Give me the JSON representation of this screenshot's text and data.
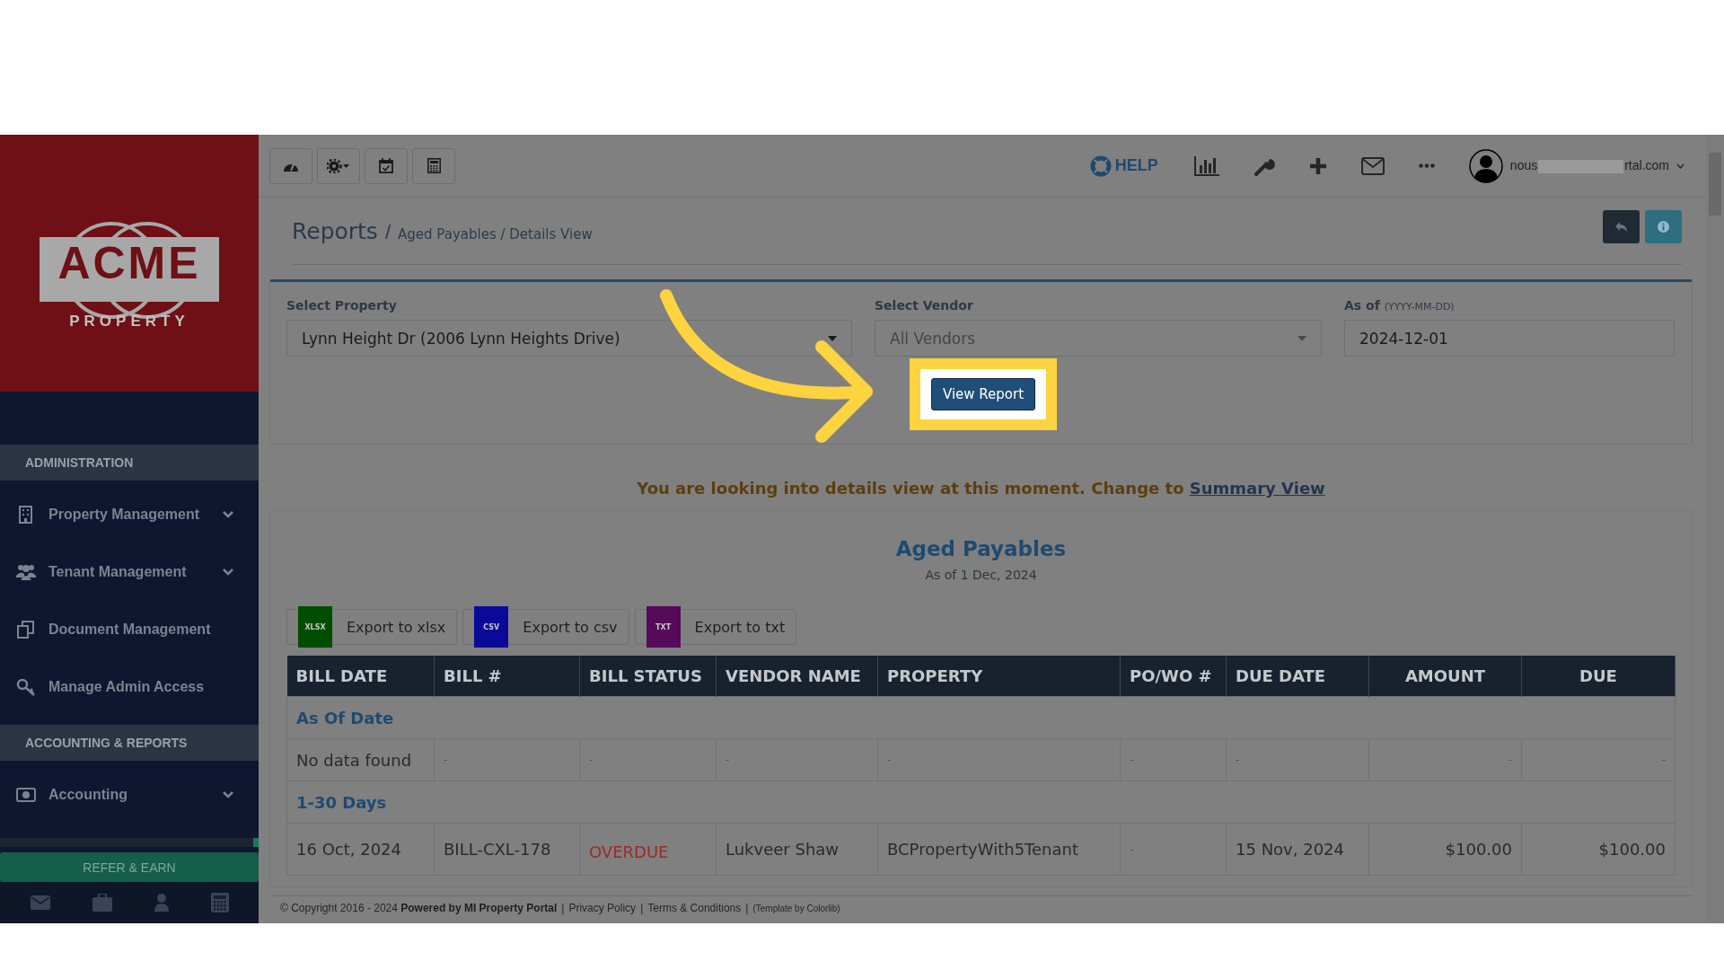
{
  "header": {
    "help": "HELP",
    "user_email_start": "nous",
    "user_email_end": "rtal.com"
  },
  "sidebar": {
    "logo": {
      "word": "ACME",
      "sub": "PROPERTY"
    },
    "sections": [
      {
        "title": "ADMINISTRATION",
        "items": [
          {
            "label": "Property Management",
            "kind": "building",
            "expandable": true
          },
          {
            "label": "Tenant Management",
            "kind": "users",
            "expandable": true
          },
          {
            "label": "Document Management",
            "kind": "documents",
            "expandable": false
          },
          {
            "label": "Manage Admin Access",
            "kind": "key",
            "expandable": false
          }
        ]
      },
      {
        "title": "ACCOUNTING & REPORTS",
        "items": [
          {
            "label": "Accounting",
            "kind": "money",
            "expandable": true
          }
        ]
      }
    ],
    "refer": "REFER & EARN"
  },
  "breadcrumb": {
    "root": "Reports",
    "separator": "/",
    "path": "Aged Payables / Details View"
  },
  "filters": {
    "property": {
      "label": "Select Property",
      "value": "Lynn Height Dr (2006 Lynn Heights Drive)"
    },
    "vendor": {
      "label": "Select Vendor",
      "placeholder": "All Vendors"
    },
    "as_of": {
      "label": "As of",
      "hint": "(YYYY-MM-DD)",
      "value": "2024-12-01"
    },
    "submit": "View Report"
  },
  "notice": {
    "text": "You are looking into details view at this moment. Change to",
    "link": "Summary View"
  },
  "report": {
    "title": "Aged Payables",
    "subtitle": "As of 1 Dec, 2024",
    "exports": [
      {
        "label": "Export to xlsx",
        "badge": "XLSX",
        "color": "#004d00"
      },
      {
        "label": "Export to csv",
        "badge": "CSV",
        "color": "#0a0a9a"
      },
      {
        "label": "Export to txt",
        "badge": "TXT",
        "color": "#560a5a"
      }
    ]
  },
  "table": {
    "columns": [
      "BILL DATE",
      "BILL #",
      "BILL STATUS",
      "VENDOR NAME",
      "PROPERTY",
      "PO/WO #",
      "DUE DATE",
      "AMOUNT",
      "DUE"
    ],
    "groups": [
      {
        "title": "As Of Date",
        "rows": [
          {
            "cells": [
              "No data found",
              "-",
              "-",
              "-",
              "-",
              "-",
              "-",
              "-",
              "-"
            ]
          }
        ]
      },
      {
        "title": "1-30 Days",
        "rows": [
          {
            "cells": [
              "16 Oct, 2024",
              "BILL-CXL-178",
              "OVERDUE",
              "Lukveer Shaw",
              "BCPropertyWith5Tenant",
              "-",
              "15 Nov, 2024",
              "$100.00",
              "$100.00"
            ]
          }
        ]
      }
    ]
  },
  "footer": {
    "copyright": "© Copyright 2016 - 2024",
    "powered": "Powered by MI Property Portal",
    "separator": "|",
    "links": [
      "Privacy Policy",
      "Terms & Conditions"
    ],
    "template": "(Template by Colorlib)"
  }
}
